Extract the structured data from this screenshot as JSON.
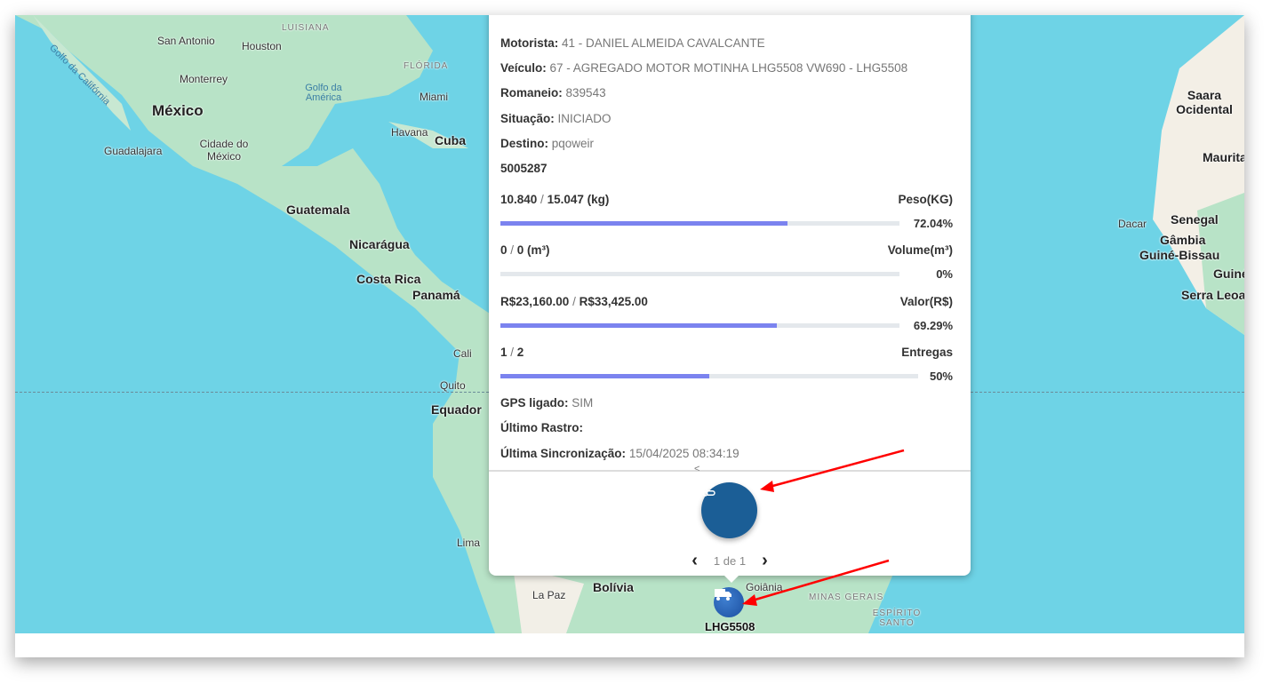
{
  "popup": {
    "fields": [
      {
        "label": "Motorista:",
        "value": "41 - DANIEL ALMEIDA CAVALCANTE"
      },
      {
        "label": "Veículo:",
        "value": "67 - AGREGADO MOTOR MOTINHA LHG5508 VW690 - LHG5508"
      },
      {
        "label": "Romaneio:",
        "value": "839543"
      },
      {
        "label": "Situação:",
        "value": "INICIADO"
      },
      {
        "label": "Destino:",
        "value": "pqoweir"
      }
    ],
    "code": "5005287",
    "metrics": [
      {
        "current": "10.840",
        "sep": " / ",
        "total": "15.047 (kg)",
        "name": "Peso(KG)",
        "percent_label": "72.04%",
        "percent": 72.04
      },
      {
        "current": "0",
        "sep": " / ",
        "total": "0 (m³)",
        "name": "Volume(m³)",
        "percent_label": "0%",
        "percent": 0
      },
      {
        "current": "R$23,160.00",
        "sep": " / ",
        "total": "R$33,425.00",
        "name": "Valor(R$)",
        "percent_label": "69.29%",
        "percent": 69.29
      },
      {
        "current": "1",
        "sep": " / ",
        "total": "2",
        "name": "Entregas",
        "percent_label": "50%",
        "percent": 50
      }
    ],
    "footer_fields": [
      {
        "label": "GPS ligado:",
        "value": "SIM"
      },
      {
        "label": "Último Rastro:",
        "value": ""
      },
      {
        "label": "Última Sincronização:",
        "value": "15/04/2025 08:34:19"
      }
    ],
    "collapse_glyph": "<",
    "route_button_icon": "route-icon",
    "pager": {
      "prev": "‹",
      "text": "1 de 1",
      "next": "›"
    }
  },
  "marker": {
    "label": "LHG5508",
    "icon": "truck-icon",
    "color": "#1b5e96"
  },
  "map_labels": {
    "san_antonio": "San Antonio",
    "houston": "Houston",
    "luisiana": "LUISIANA",
    "florida": "FLÓRIDA",
    "golfo_california": "Golfo da Califórnia",
    "monterrey": "Monterrey",
    "mexico": "México",
    "golfo_mexico": "Golfo da América",
    "miami": "Miami",
    "havana": "Havana",
    "cuba": "Cuba",
    "guadalajara": "Guadalajara",
    "cidade_mexico": "Cidade do México",
    "guatemala": "Guatemala",
    "nicaragua": "Nicarágua",
    "costa_rica": "Costa Rica",
    "panama": "Panamá",
    "cali": "Cali",
    "quito": "Quito",
    "equador": "Equador",
    "lima": "Lima",
    "la_paz": "La Paz",
    "bolivia": "Bolívia",
    "goiania": "Goiânia",
    "minas": "MINAS GERAIS",
    "espirito": "ESPÍRITO SANTO",
    "saara": "Saara Ocidental",
    "mauritania": "Maurita",
    "dacar": "Dacar",
    "senegal": "Senegal",
    "gambia": "Gâmbia",
    "guine_bissau": "Guiné-Bissau",
    "guine": "Guiné",
    "serra_leoa": "Serra Leoa"
  }
}
